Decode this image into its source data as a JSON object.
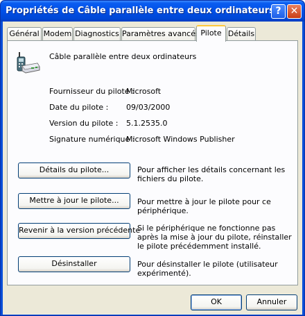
{
  "window": {
    "title": "Propriétés de Câble parallèle entre deux ordinateurs",
    "help_glyph": "?",
    "close_glyph": "✕"
  },
  "tabs": [
    {
      "label": "Général"
    },
    {
      "label": "Modem"
    },
    {
      "label": "Diagnostics"
    },
    {
      "label": "Paramètres avancés"
    },
    {
      "label": "Pilote",
      "active": true
    },
    {
      "label": "Détails"
    }
  ],
  "device": {
    "icon": "modem-phone-icon",
    "name": "Câble parallèle entre deux ordinateurs"
  },
  "driver_info": [
    {
      "label": "Fournisseur du pilote :",
      "value": "Microsoft"
    },
    {
      "label": "Date du pilote :",
      "value": "09/03/2000"
    },
    {
      "label": "Version du pilote :",
      "value": "5.1.2535.0"
    },
    {
      "label": "Signature numérique :",
      "value": "Microsoft Windows Publisher"
    }
  ],
  "actions": [
    {
      "button": "Détails du pilote...",
      "description": "Pour afficher les détails concernant les fichiers du pilote."
    },
    {
      "button": "Mettre à jour le pilote...",
      "description": "Pour mettre à jour le pilote pour ce périphérique."
    },
    {
      "button": "Revenir à la version précédente",
      "description": "Si le périphérique ne fonctionne pas après la mise à jour du pilote, réinstaller le pilote précédemment installé."
    },
    {
      "button": "Désinstaller",
      "description": "Pour désinstaller le pilote (utilisateur expérimenté)."
    }
  ],
  "dialog_buttons": {
    "ok": "OK",
    "cancel": "Annuler"
  },
  "colors": {
    "titlebar": "#0050e8",
    "face": "#ece9d8",
    "active_tab_accent": "#ffc83c"
  }
}
